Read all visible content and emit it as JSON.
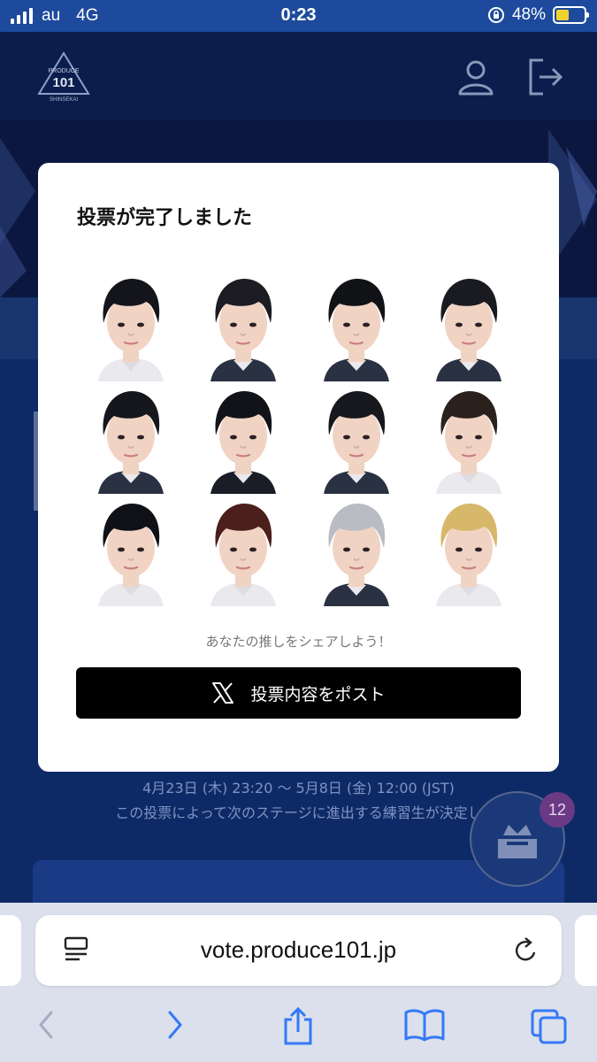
{
  "status_bar": {
    "carrier": "au",
    "network": "4G",
    "time": "0:23",
    "battery_percent": "48%",
    "battery_level": 0.48
  },
  "header": {
    "logo_text_top": "PRODUCE",
    "logo_text_num": "101",
    "logo_text_bottom": "SHINSEKAI"
  },
  "modal": {
    "title": "投票が完了しました",
    "trainees": [
      {
        "hair": "#14151b",
        "shirt": "#e9e9ee"
      },
      {
        "hair": "#1c1c22",
        "shirt": "#2a3142"
      },
      {
        "hair": "#111216",
        "shirt": "#2a3142"
      },
      {
        "hair": "#1a1b20",
        "shirt": "#2a3142"
      },
      {
        "hair": "#16171c",
        "shirt": "#2a3142"
      },
      {
        "hair": "#121318",
        "shirt": "#1b1d26"
      },
      {
        "hair": "#17181d",
        "shirt": "#2a3142"
      },
      {
        "hair": "#2a211c",
        "shirt": "#e9e9ee"
      },
      {
        "hair": "#101116",
        "shirt": "#e9e9ee"
      },
      {
        "hair": "#4a1f1c",
        "shirt": "#e9e9ee"
      },
      {
        "hair": "#b9bcc3",
        "shirt": "#2a3142"
      },
      {
        "hair": "#d7b86a",
        "shirt": "#e9e9ee"
      }
    ],
    "share_prompt": "あなたの推しをシェアしよう！",
    "post_button_label": "投票内容をポスト",
    "post_icon": "x-logo-icon"
  },
  "background": {
    "period_text": "4月23日 (木) 23:20 〜 5月8日 (金) 12:00 (JST)",
    "description_text": "この投票によって次のステージに進出する練習生が決定し",
    "badge_count": "12"
  },
  "browser": {
    "url": "vote.produce101.jp"
  },
  "colors": {
    "status_bar": "#1d4a9c",
    "header": "#0b1d4c",
    "page_bg": "#0e2a66",
    "button": "#000000",
    "browser_chrome": "#dbe0ec",
    "link_blue": "#3478f6"
  }
}
